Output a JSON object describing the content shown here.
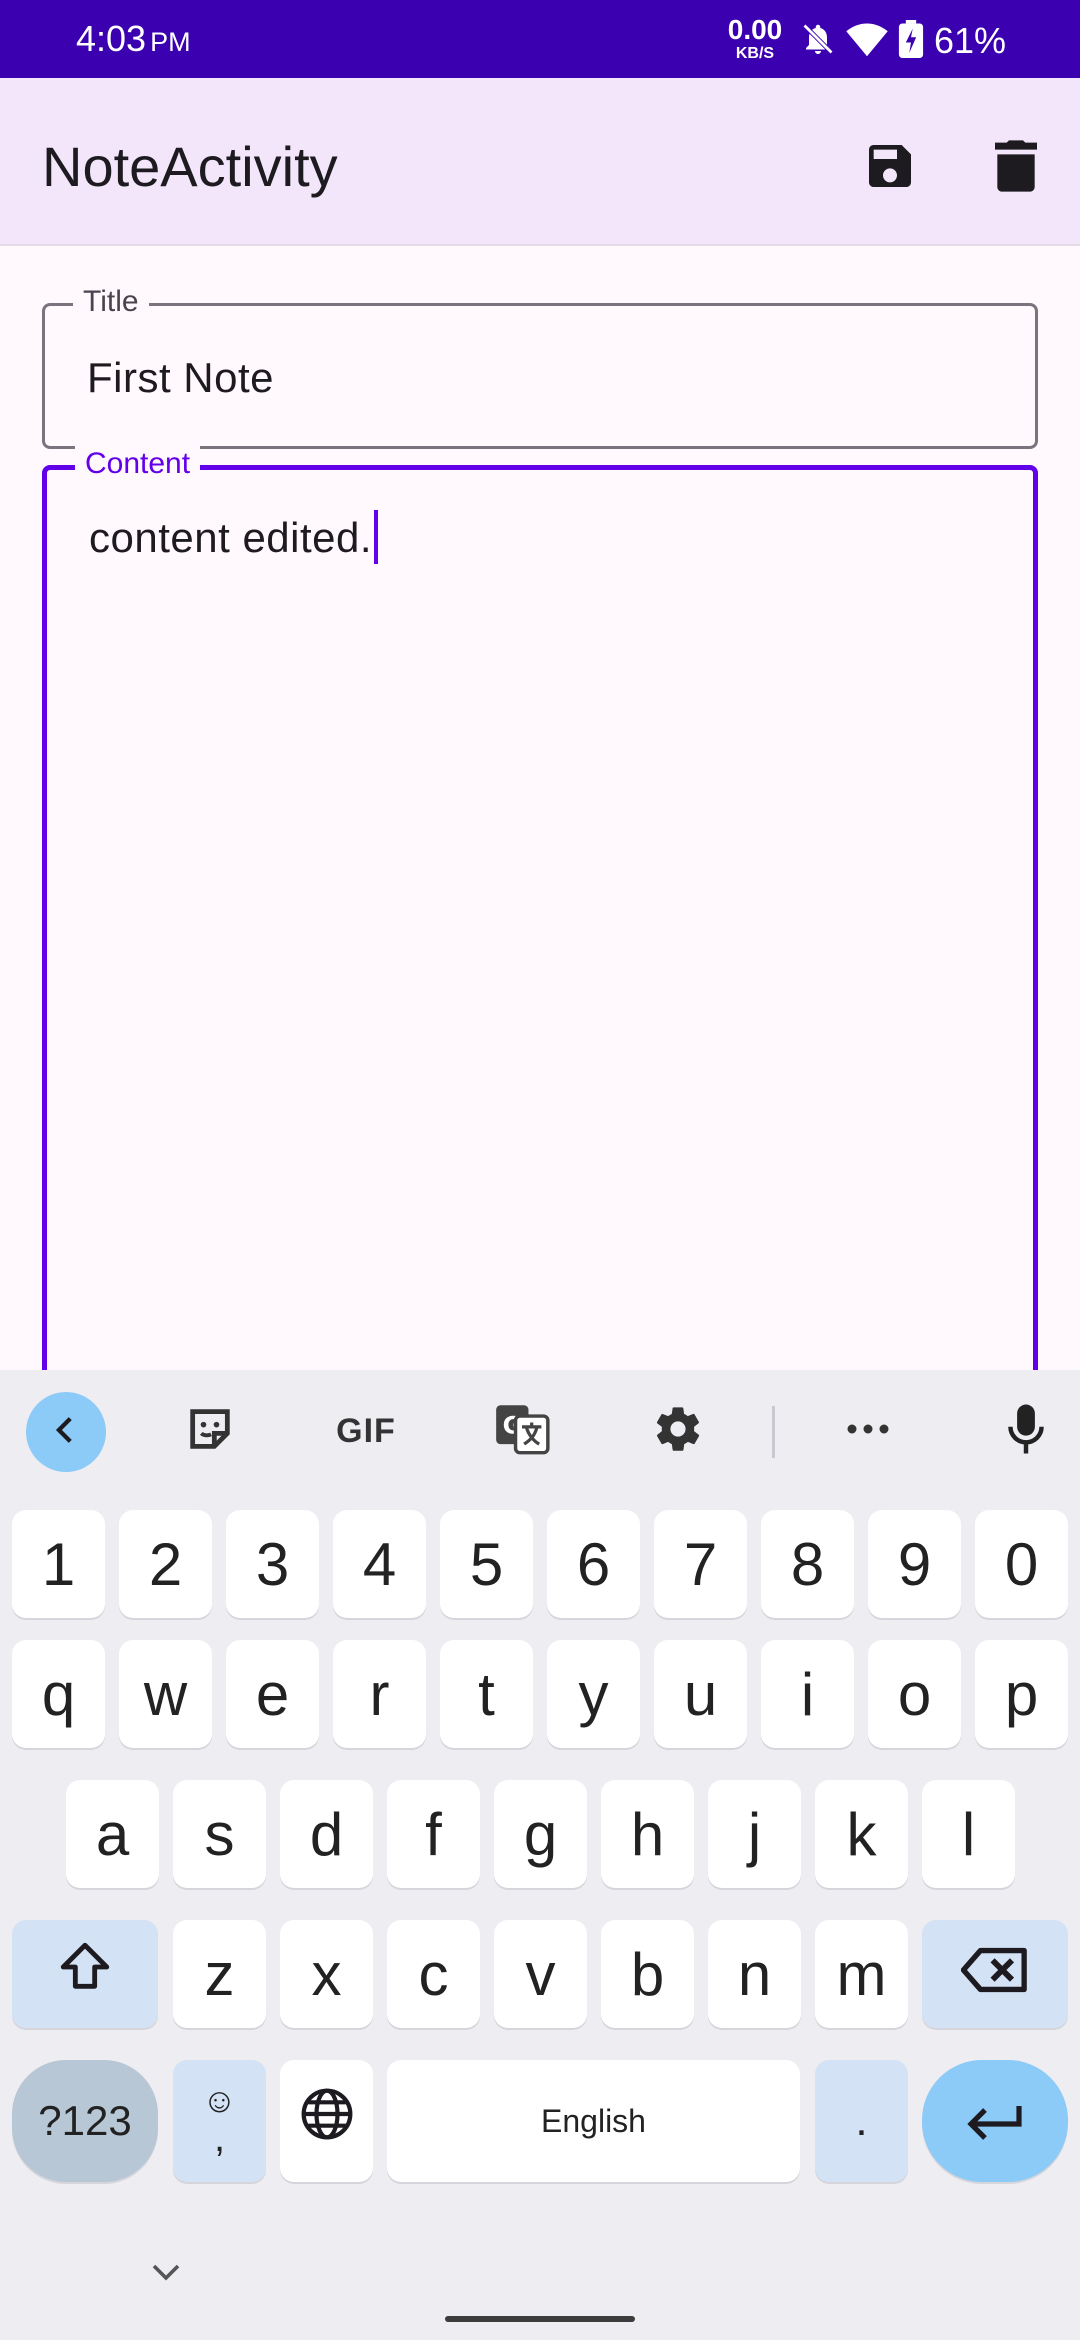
{
  "status_bar": {
    "time": "4:03",
    "ampm": "PM",
    "net_speed": "0.00",
    "net_unit": "KB/S",
    "battery": "61%",
    "icons": [
      "bell-off-icon",
      "wifi-icon",
      "battery-charging-icon"
    ]
  },
  "app_bar": {
    "title": "NoteActivity",
    "actions": [
      "save-icon",
      "delete-icon"
    ]
  },
  "form": {
    "title_label": "Title",
    "title_value": "First Note",
    "content_label": "Content",
    "content_value": "content edited."
  },
  "keyboard": {
    "toolbar": [
      "back-icon",
      "sticker-icon",
      "GIF",
      "translate-icon",
      "settings-icon",
      "more-icon",
      "mic-icon"
    ],
    "gif_label": "GIF",
    "rows": {
      "numbers": [
        "1",
        "2",
        "3",
        "4",
        "5",
        "6",
        "7",
        "8",
        "9",
        "0"
      ],
      "row1": [
        "q",
        "w",
        "e",
        "r",
        "t",
        "y",
        "u",
        "i",
        "o",
        "p"
      ],
      "row2": [
        "a",
        "s",
        "d",
        "f",
        "g",
        "h",
        "j",
        "k",
        "l"
      ],
      "row3": [
        "z",
        "x",
        "c",
        "v",
        "b",
        "n",
        "m"
      ]
    },
    "symbols_label": "?123",
    "emoji_comma": ",",
    "space_label": "English",
    "period_label": "."
  },
  "colors": {
    "status_bar": "#3b00b0",
    "app_bar": "#f3e6fb",
    "accent": "#6200ea",
    "background": "#fff8fd"
  }
}
